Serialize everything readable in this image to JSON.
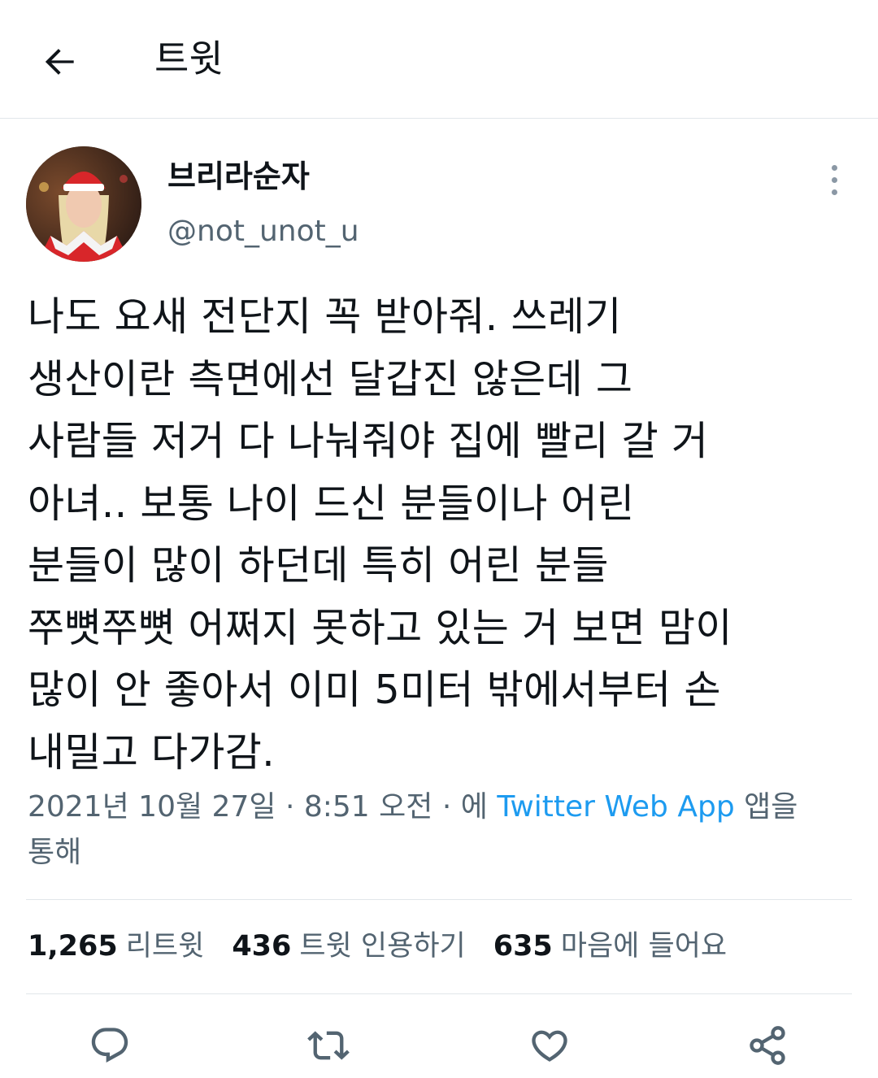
{
  "header": {
    "title": "트윗",
    "back_icon": "arrow-left-icon"
  },
  "tweet": {
    "author": {
      "display_name": "브리라순자",
      "handle": "@not_unot_u"
    },
    "text_lines": [
      "나도 요새 전단지 꼭 받아줘. 쓰레기",
      "생산이란 측면에선 달갑진 않은데 그",
      "사람들 저거 다 나눠줘야 집에 빨리 갈 거",
      "아녀.. 보통 나이 드신 분들이나 어린",
      "분들이 많이 하던데 특히 어린 분들",
      "쭈뼛쭈뼛 어쩌지 못하고 있는 거 보면 맘이",
      "많이 안 좋아서 이미 5미터 밖에서부터 손",
      "내밀고 다가감."
    ],
    "meta": {
      "date": "2021년 10월 27일",
      "separator": "·",
      "time": "8:51 오전",
      "via_prefix": "에",
      "app": "Twitter Web App",
      "via_suffix": "앱을",
      "via_tail": "통해"
    },
    "stats": {
      "retweets": {
        "count": "1,265",
        "label": "리트윗"
      },
      "quotes": {
        "count": "436",
        "label": "트윗 인용하기"
      },
      "likes": {
        "count": "635",
        "label": "마음에 들어요"
      }
    }
  },
  "actions": [
    "reply-icon",
    "retweet-icon",
    "like-icon",
    "share-icon"
  ],
  "colors": {
    "text": "#0f1419",
    "secondary": "#536471",
    "link": "#1d9bf0",
    "divider": "#e1e6ea",
    "icon": "#536471"
  }
}
